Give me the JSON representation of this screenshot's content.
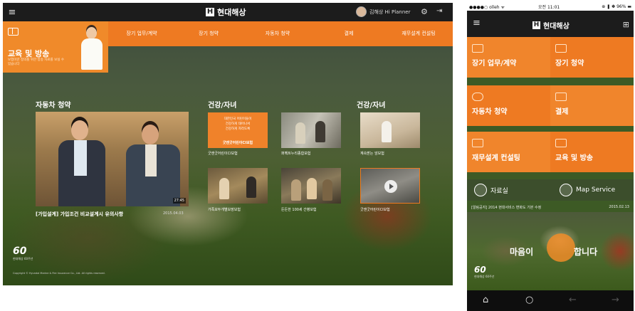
{
  "tablet": {
    "logo": "현대해상",
    "logo_mark": "H",
    "user_label": "김해상 Hi Planner",
    "menu_icon": "≡",
    "gear_icon": "⚙",
    "logout_icon": "⇥",
    "edu_title": "교육 및 방송",
    "edu_desc": "보험이란 정의를 위한 방송 자료를 보실 수 있습니다",
    "nav": [
      "장기 업무/계약",
      "장기 청약",
      "자동차 청약",
      "결제",
      "재무설계 컨설팅"
    ],
    "sections": {
      "left": "자동차 청약",
      "middle": "건강/자녀",
      "right": "건강/자녀"
    },
    "featured": {
      "caption": "[가입설계] 가입조건 비교설계시 유의사항",
      "date": "2015.04.03",
      "duration": "27:45"
    },
    "promo": {
      "lines": [
        "대한민국 어린이들이",
        "건강하게 태어나서",
        "건강하게 자라도록"
      ],
      "headline": "굿앤굿어린이CI보험"
    },
    "thumb_captions": [
      "굿앤굿어린이CI보험",
      "퍼펙트누리종합보험",
      "계속받는 암보험",
      "가족모두개별보장보험",
      "든든한 100세 간병보험",
      "굿앤굿어린이CI보험"
    ],
    "brand": "60",
    "brand_sub": "현대해상 60주년",
    "copyright": "Copyright © Hyundai Marine & Fire Insurance Co., Ltd. All rights reserved."
  },
  "phone": {
    "status": {
      "carrier": "●●●●○ olleh ᯤ",
      "time": "오전 11:01",
      "right": "⊕ ❚ ✽ 96% ▬"
    },
    "logo": "현대해상",
    "logo_mark": "H",
    "menu_icon": "≡",
    "grid_icon": "⊞",
    "tiles": [
      "장기 업무/계약",
      "장기 청약",
      "자동차 청약",
      "결제",
      "재무설계 컨설팅",
      "교육 및 방송"
    ],
    "btn_library": "자료실",
    "btn_map": "Map Service",
    "news_title": "[알림공지] 2014 현대서비스 변화도 기본 수정",
    "news_date": "2015.02.13",
    "slogan_a": "마음이",
    "slogan_b": "합니다",
    "brand": "60",
    "brand_sub": "현대해상 60주년",
    "nav_home": "⌂",
    "nav_circle": "○",
    "nav_back": "←",
    "nav_forward": "→"
  },
  "colors": {
    "accent": "#ee7a22",
    "accent_light": "#f08a2a",
    "dark_bar": "#1c1c1c"
  }
}
